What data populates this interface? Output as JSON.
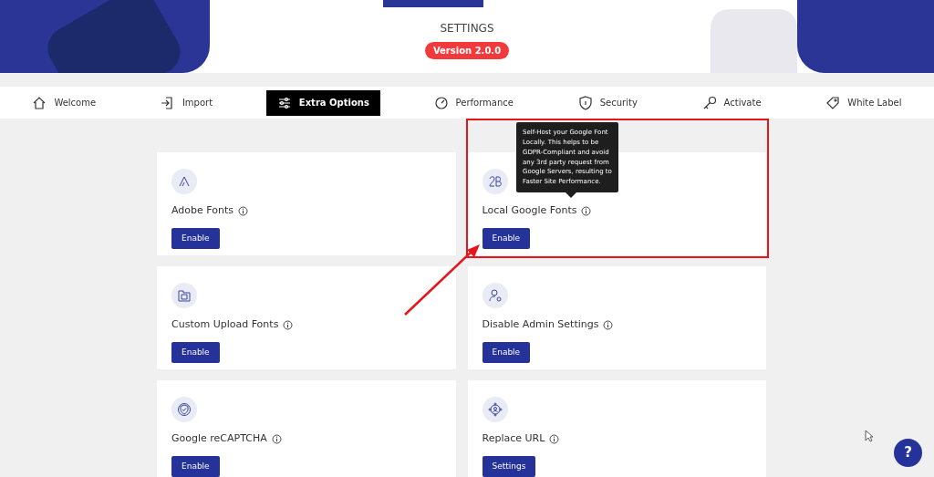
{
  "header": {
    "subtitle": "SETTINGS",
    "version": "Version 2.0.0"
  },
  "tabs": [
    {
      "label": "Welcome",
      "selected": false
    },
    {
      "label": "Import",
      "selected": false
    },
    {
      "label": "Extra Options",
      "selected": true
    },
    {
      "label": "Performance",
      "selected": false
    },
    {
      "label": "Security",
      "selected": false
    },
    {
      "label": "Activate",
      "selected": false
    },
    {
      "label": "White Label",
      "selected": false
    }
  ],
  "tooltip": {
    "text": "Self-Host your Google Font Locally. This helps to be GDPR-Compliant and avoid any 3rd party request from Google Servers, resulting to Faster Site Performance."
  },
  "cards": [
    {
      "title": "Adobe Fonts",
      "button": "Enable",
      "highlighted": false
    },
    {
      "title": "Local Google Fonts",
      "button": "Enable",
      "highlighted": true
    },
    {
      "title": "Custom Upload Fonts",
      "button": "Enable",
      "highlighted": false
    },
    {
      "title": "Disable Admin Settings",
      "button": "Enable",
      "highlighted": false
    },
    {
      "title": "Google reCAPTCHA",
      "button": "Enable",
      "highlighted": false
    },
    {
      "title": "Replace URL",
      "button": "Settings",
      "highlighted": false
    }
  ],
  "help_button": "?"
}
